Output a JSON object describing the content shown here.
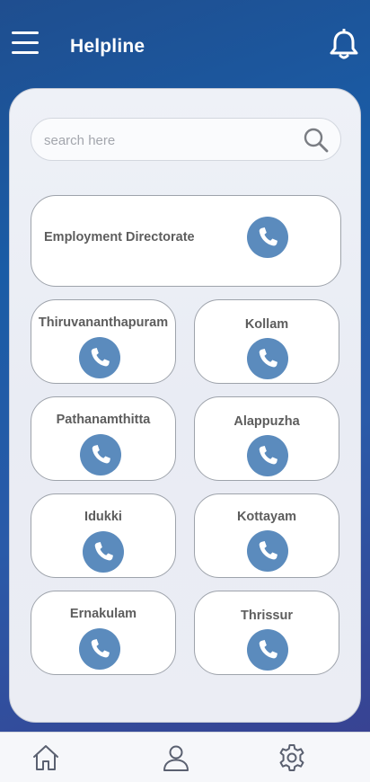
{
  "header": {
    "title": "Helpline",
    "menu_icon": "hamburger-menu-icon",
    "notification_icon": "bell-icon"
  },
  "search": {
    "placeholder": "search here",
    "icon": "search-icon"
  },
  "featured": {
    "label": "Employment Directorate",
    "icon": "phone-icon"
  },
  "districts": [
    {
      "label": "Thiruvananthapuram"
    },
    {
      "label": "Kollam"
    },
    {
      "label": "Pathanamthitta"
    },
    {
      "label": "Alappuzha"
    },
    {
      "label": "Idukki"
    },
    {
      "label": "Kottayam"
    },
    {
      "label": "Ernakulam"
    },
    {
      "label": "Thrissur"
    }
  ],
  "bottom_nav": [
    {
      "name": "home",
      "icon": "home-icon"
    },
    {
      "name": "profile",
      "icon": "user-icon"
    },
    {
      "name": "settings",
      "icon": "gear-icon"
    }
  ],
  "colors": {
    "accent": "#5b8bbd",
    "header_bg": "#1f5ca8"
  }
}
